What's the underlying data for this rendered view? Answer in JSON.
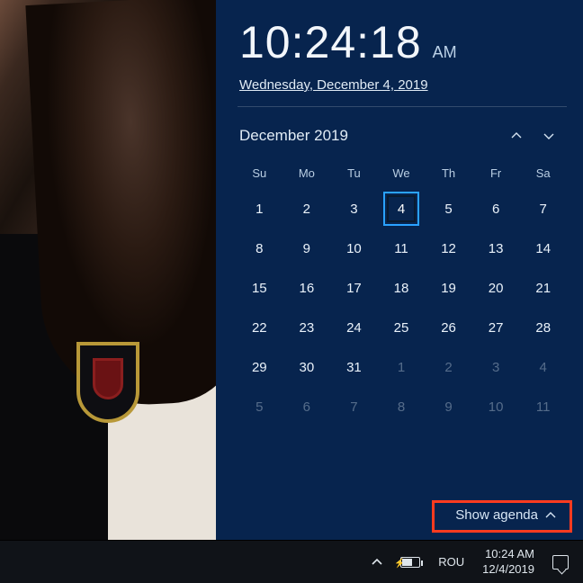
{
  "clock": {
    "time": "10:24:18",
    "ampm": "AM",
    "date_full": "Wednesday, December 4, 2019"
  },
  "calendar": {
    "month_label": "December 2019",
    "dow": [
      "Su",
      "Mo",
      "Tu",
      "We",
      "Th",
      "Fr",
      "Sa"
    ],
    "today": 4,
    "weeks": [
      [
        {
          "n": 1
        },
        {
          "n": 2
        },
        {
          "n": 3
        },
        {
          "n": 4,
          "today": true
        },
        {
          "n": 5
        },
        {
          "n": 6
        },
        {
          "n": 7
        }
      ],
      [
        {
          "n": 8
        },
        {
          "n": 9
        },
        {
          "n": 10
        },
        {
          "n": 11
        },
        {
          "n": 12
        },
        {
          "n": 13
        },
        {
          "n": 14
        }
      ],
      [
        {
          "n": 15
        },
        {
          "n": 16
        },
        {
          "n": 17
        },
        {
          "n": 18
        },
        {
          "n": 19
        },
        {
          "n": 20
        },
        {
          "n": 21
        }
      ],
      [
        {
          "n": 22
        },
        {
          "n": 23
        },
        {
          "n": 24
        },
        {
          "n": 25
        },
        {
          "n": 26
        },
        {
          "n": 27
        },
        {
          "n": 28
        }
      ],
      [
        {
          "n": 29
        },
        {
          "n": 30
        },
        {
          "n": 31
        },
        {
          "n": 1,
          "dim": true
        },
        {
          "n": 2,
          "dim": true
        },
        {
          "n": 3,
          "dim": true
        },
        {
          "n": 4,
          "dim": true
        }
      ],
      [
        {
          "n": 5,
          "dim": true
        },
        {
          "n": 6,
          "dim": true
        },
        {
          "n": 7,
          "dim": true
        },
        {
          "n": 8,
          "dim": true
        },
        {
          "n": 9,
          "dim": true
        },
        {
          "n": 10,
          "dim": true
        },
        {
          "n": 11,
          "dim": true
        }
      ]
    ],
    "show_agenda_label": "Show agenda"
  },
  "taskbar": {
    "ime": "ROU",
    "clock_time": "10:24 AM",
    "clock_date": "12/4/2019"
  },
  "colors": {
    "accent": "#2aa2ff",
    "highlight": "#ff3b1f"
  }
}
